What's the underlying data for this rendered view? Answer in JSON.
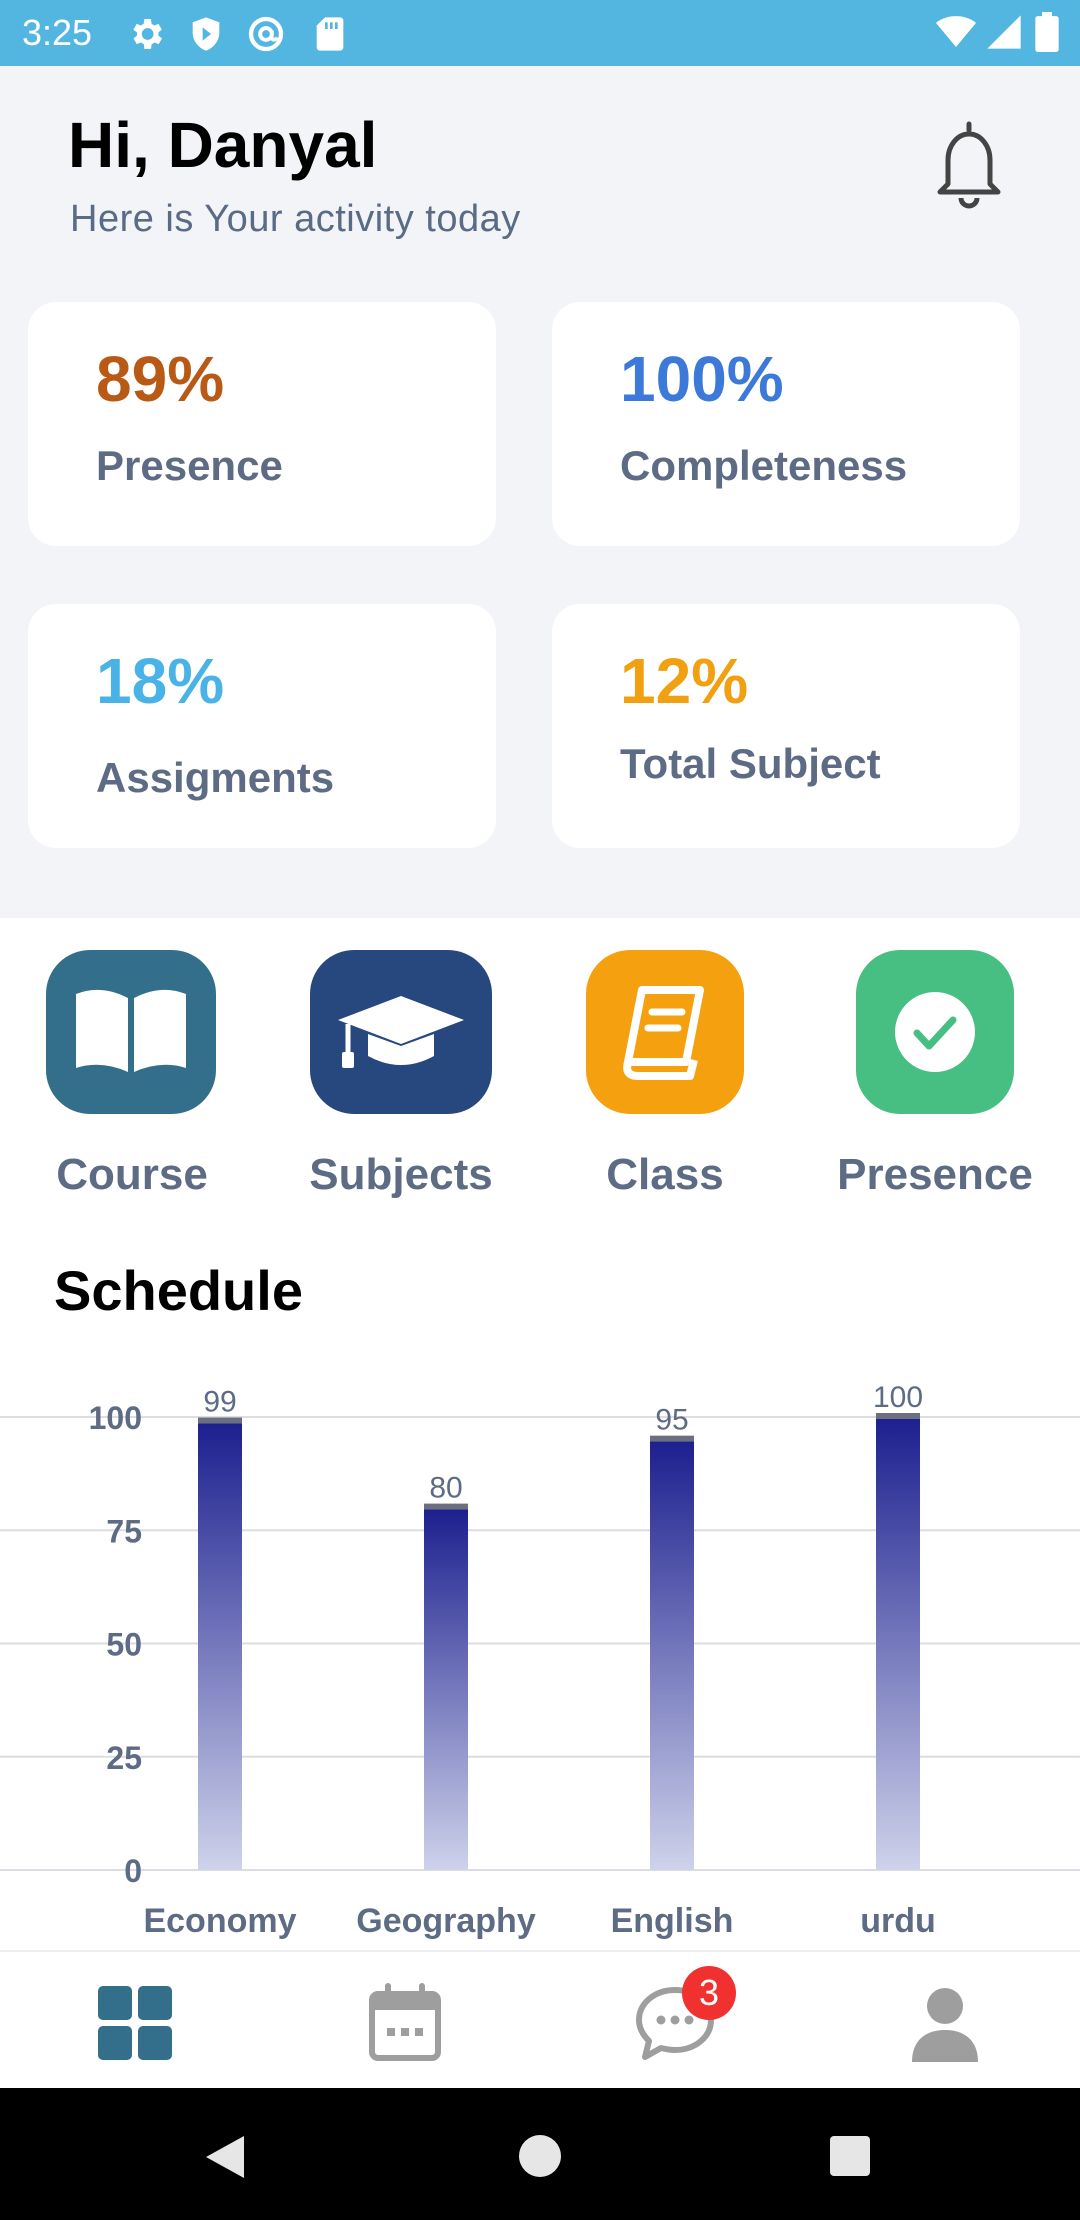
{
  "status_bar": {
    "time": "3:25",
    "icons": [
      "gear-icon",
      "shield-icon",
      "at-sign-icon",
      "sd-card-icon",
      "wifi-icon",
      "signal-icon",
      "battery-icon"
    ],
    "color": "#52b6e0"
  },
  "header": {
    "greeting": "Hi, Danyal",
    "subtitle": "Here is Your activity today",
    "notification_icon": "bell-icon"
  },
  "stats": [
    {
      "value": "89%",
      "label": "Presence",
      "color": "#b85a16"
    },
    {
      "value": "100%",
      "label": "Completeness",
      "color": "#3d79d8"
    },
    {
      "value": "18%",
      "label": "Assigments",
      "color": "#49b2e6"
    },
    {
      "value": "12%",
      "label": "Total Subject",
      "color": "#f0a010"
    }
  ],
  "actions": [
    {
      "label": "Course",
      "icon": "open-book-icon",
      "color": "#336f8a"
    },
    {
      "label": "Subjects",
      "icon": "graduation-cap-icon",
      "color": "#26487e"
    },
    {
      "label": "Class",
      "icon": "notebook-icon",
      "color": "#f5a00f"
    },
    {
      "label": "Presence",
      "icon": "check-circle-icon",
      "color": "#47be82"
    }
  ],
  "schedule": {
    "title": "Schedule"
  },
  "chart_data": {
    "type": "bar",
    "categories": [
      "Economy",
      "Geography",
      "English",
      "urdu"
    ],
    "values": [
      99,
      80,
      95,
      100
    ],
    "ylim": [
      0,
      100
    ],
    "yticks": [
      "0",
      "25",
      "50",
      "75",
      "100"
    ],
    "grid": true,
    "bar_gradient": [
      "#1c1f8e",
      "#ced2ea"
    ],
    "data_labels": [
      "99",
      "80",
      "95",
      "100"
    ]
  },
  "bottom_nav": {
    "items": [
      "dashboard-icon",
      "calendar-icon",
      "chat-icon",
      "profile-icon"
    ],
    "active_color": "#336f8a",
    "inactive_color": "#9e9e9e",
    "chat_badge": "3"
  },
  "system_nav": {
    "items": [
      "back-icon",
      "home-icon",
      "recents-icon"
    ]
  }
}
